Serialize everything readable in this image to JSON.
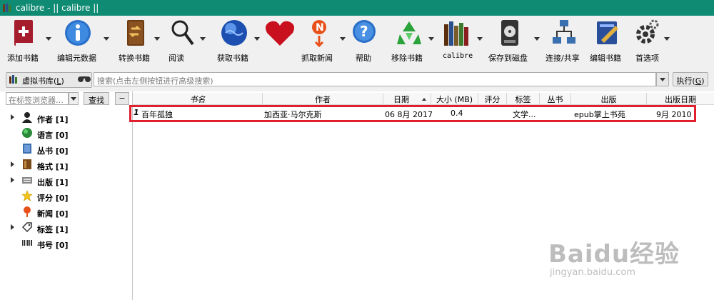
{
  "window": {
    "title": "calibre - || calibre ||"
  },
  "toolbar": {
    "buttons": [
      {
        "label": "添加书籍",
        "icon": "add-book-icon"
      },
      {
        "label": "编辑元数据",
        "icon": "info-icon"
      },
      {
        "label": "转换书籍",
        "icon": "convert-book-icon"
      },
      {
        "label": "阅读",
        "icon": "magnifier-icon"
      },
      {
        "label": "获取书籍",
        "icon": "globe-icon"
      },
      {
        "label": "",
        "icon": "heart-icon"
      },
      {
        "label": "抓取新闻",
        "icon": "news-icon"
      },
      {
        "label": "帮助",
        "icon": "help-icon"
      },
      {
        "label": "移除书籍",
        "icon": "recycle-icon"
      },
      {
        "label": "calibre",
        "icon": "library-icon"
      },
      {
        "label": "保存到磁盘",
        "icon": "disk-icon"
      },
      {
        "label": "连接/共享",
        "icon": "network-icon"
      },
      {
        "label": "编辑书籍",
        "icon": "edit-book-icon"
      },
      {
        "label": "首选项",
        "icon": "gear-icon"
      }
    ]
  },
  "search": {
    "virtual_library_label": "虚拟书库(",
    "virtual_library_key": "L",
    "virtual_library_end": ")",
    "placeholder": "搜索(点击左侧按钮进行高级搜索)",
    "execute_label": "执行(",
    "execute_key": "G",
    "execute_end": ")"
  },
  "tag_browser": {
    "filter_placeholder": "在标签浏览器…",
    "find_label": "查找",
    "collapse_label": "−",
    "items": [
      {
        "label": "作者 [1]",
        "icon": "person-icon",
        "expandable": true
      },
      {
        "label": "语言 [0]",
        "icon": "language-icon",
        "expandable": false
      },
      {
        "label": "丛书 [0]",
        "icon": "series-icon",
        "expandable": false
      },
      {
        "label": "格式 [1]",
        "icon": "format-icon",
        "expandable": true
      },
      {
        "label": "出版 [1]",
        "icon": "publisher-icon",
        "expandable": true
      },
      {
        "label": "评分 [0]",
        "icon": "star-icon",
        "expandable": false
      },
      {
        "label": "新闻 [0]",
        "icon": "news-icon",
        "expandable": false
      },
      {
        "label": "标签 [1]",
        "icon": "tag-icon",
        "expandable": true
      },
      {
        "label": "书号 [0]",
        "icon": "barcode-icon",
        "expandable": false
      }
    ]
  },
  "book_table": {
    "columns": [
      "书名",
      "作者",
      "日期",
      "大小 (MB)",
      "评分",
      "标签",
      "丛书",
      "出版",
      "出版日期"
    ],
    "rows": [
      {
        "num": "1",
        "title": "百年孤独",
        "author": "加西亚·马尔克斯",
        "date": "06 8月 2017",
        "size": "0.4",
        "rating": "",
        "tags": "文学...",
        "series": "",
        "publisher": "epub掌上书苑",
        "pubdate": "9月 2010"
      }
    ]
  },
  "watermark": {
    "brand": "Baidu经验",
    "url": "jingyan.baidu.com"
  },
  "colors": {
    "titlebar": "#0f8a73",
    "highlight": "#e0202c"
  }
}
